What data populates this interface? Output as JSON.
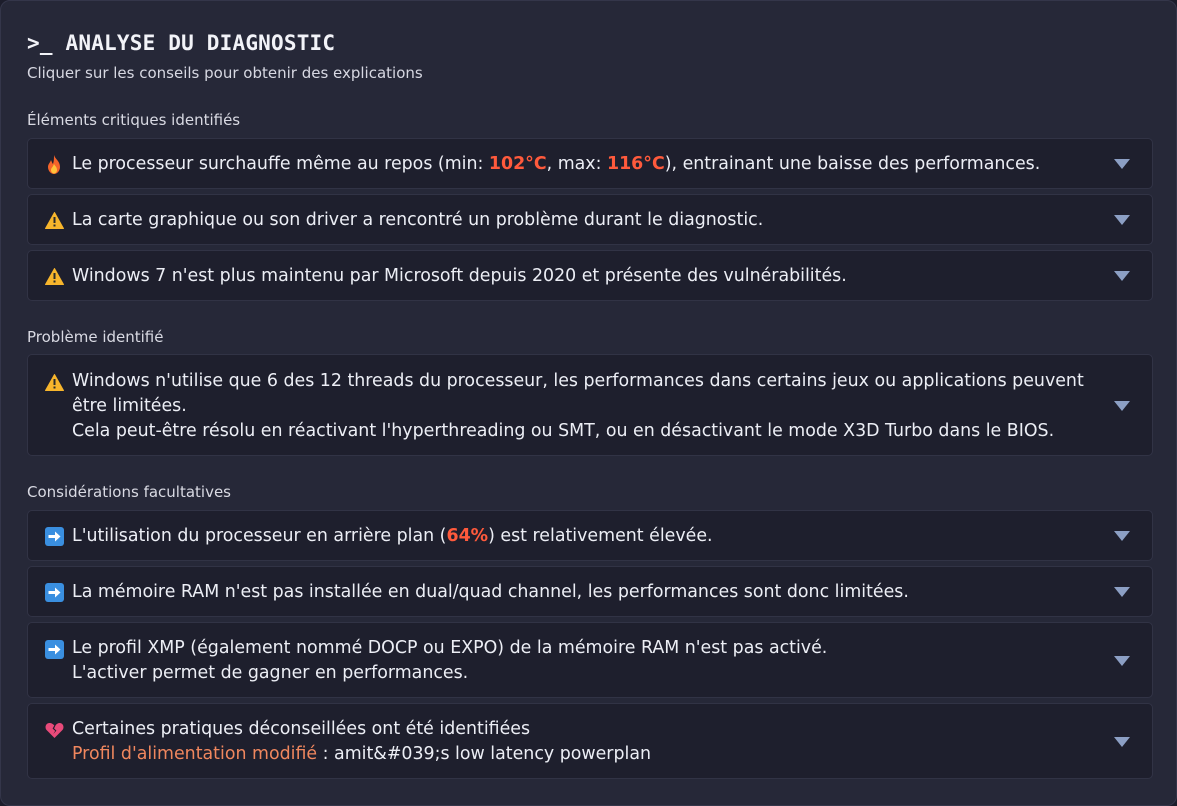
{
  "header": {
    "title": ">_ ANALYSE DU DIAGNOSTIC",
    "subtitle": "Cliquer sur les conseils pour obtenir des explications"
  },
  "sections": {
    "critical": {
      "title": "Éléments critiques identifiés",
      "items": [
        {
          "icon": "fire-icon",
          "text_before": "Le processeur surchauffe même au repos (min: ",
          "min_temp": "102°C",
          "text_mid": ", max: ",
          "max_temp": "116°C",
          "text_after": "), entrainant une baisse des performances."
        },
        {
          "icon": "warning-icon",
          "text": "La carte graphique ou son driver a rencontré un problème durant le diagnostic."
        },
        {
          "icon": "warning-icon",
          "text": "Windows 7 n'est plus maintenu par Microsoft depuis 2020 et présente des vulnérabilités."
        }
      ]
    },
    "problem": {
      "title": "Problème identifié",
      "items": [
        {
          "icon": "warning-icon",
          "line1": "Windows n'utilise que 6 des 12 threads du processeur, les performances dans certains jeux ou applications peuvent",
          "line2": "être limitées.",
          "line3": "Cela peut-être résolu en réactivant l'hyperthreading ou SMT, ou en désactivant le mode X3D Turbo dans le BIOS."
        }
      ]
    },
    "optional": {
      "title": "Considérations facultatives",
      "items": [
        {
          "icon": "arrow-right-icon",
          "text_before": "L'utilisation du processeur en arrière plan (",
          "value": "64%",
          "text_after": ") est relativement élevée."
        },
        {
          "icon": "arrow-right-icon",
          "text": "La mémoire RAM n'est pas installée en dual/quad channel, les performances sont donc limitées."
        },
        {
          "icon": "arrow-right-icon",
          "line1": "Le profil XMP (également nommé DOCP ou EXPO) de la mémoire RAM n'est pas activé.",
          "line2": "L'activer permet de gagner en performances."
        },
        {
          "icon": "broken-heart-icon",
          "line1": "Certaines pratiques déconseillées ont été identifiées",
          "link_label": "Profil d'alimentation modifié",
          "link_value": " : amit&#039;s low latency powerplan"
        }
      ]
    }
  },
  "colors": {
    "background": "#262838",
    "card": "#1e1f2d",
    "highlight_red": "#ff5a3c",
    "highlight_orange": "#f0875e",
    "chevron": "#8c9fc4"
  }
}
